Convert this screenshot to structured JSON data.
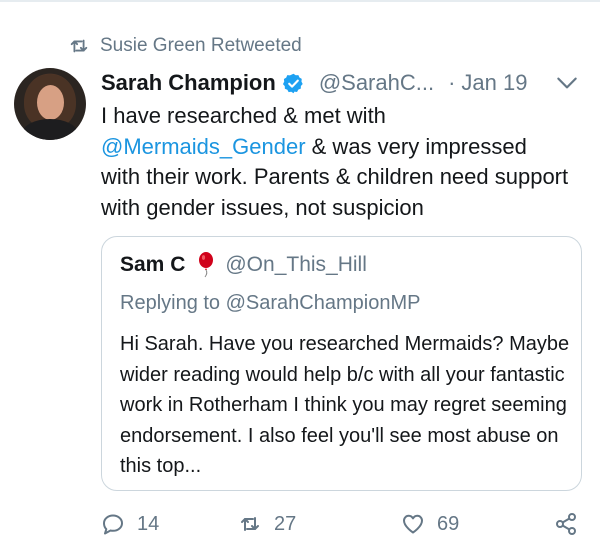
{
  "retweet_context": {
    "text": "Susie Green Retweeted",
    "icon": "retweet-icon"
  },
  "tweet": {
    "author_name": "Sarah Champion",
    "verified_icon": "verified-badge-icon",
    "handle": "@SarahC...",
    "separator": "·",
    "date": "Jan 19",
    "menu_icon": "chevron-down-icon",
    "text_part1": "I have researched & met with ",
    "mention": "@Mermaids_Gender",
    "text_part2": " & was very impressed with their work. Parents & children need support with gender issues, not suspicion"
  },
  "quoted_tweet": {
    "author_name": "Sam C",
    "emoji_icon": "balloon-icon",
    "handle": "@On_This_Hill",
    "replying_to": "Replying to @SarahChampionMP",
    "text": "Hi Sarah. Have you researched Mermaids? Maybe wider reading would help b/c with all your fantastic work in Rotherham I think you may regret seeming endorsement.  I also feel you'll see most abuse on this top..."
  },
  "actions": {
    "reply_count": "14",
    "retweet_count": "27",
    "like_count": "69"
  },
  "colors": {
    "link": "#1b95e0",
    "muted": "#657786",
    "verified": "#1da1f2",
    "balloon": "#d0021b"
  }
}
